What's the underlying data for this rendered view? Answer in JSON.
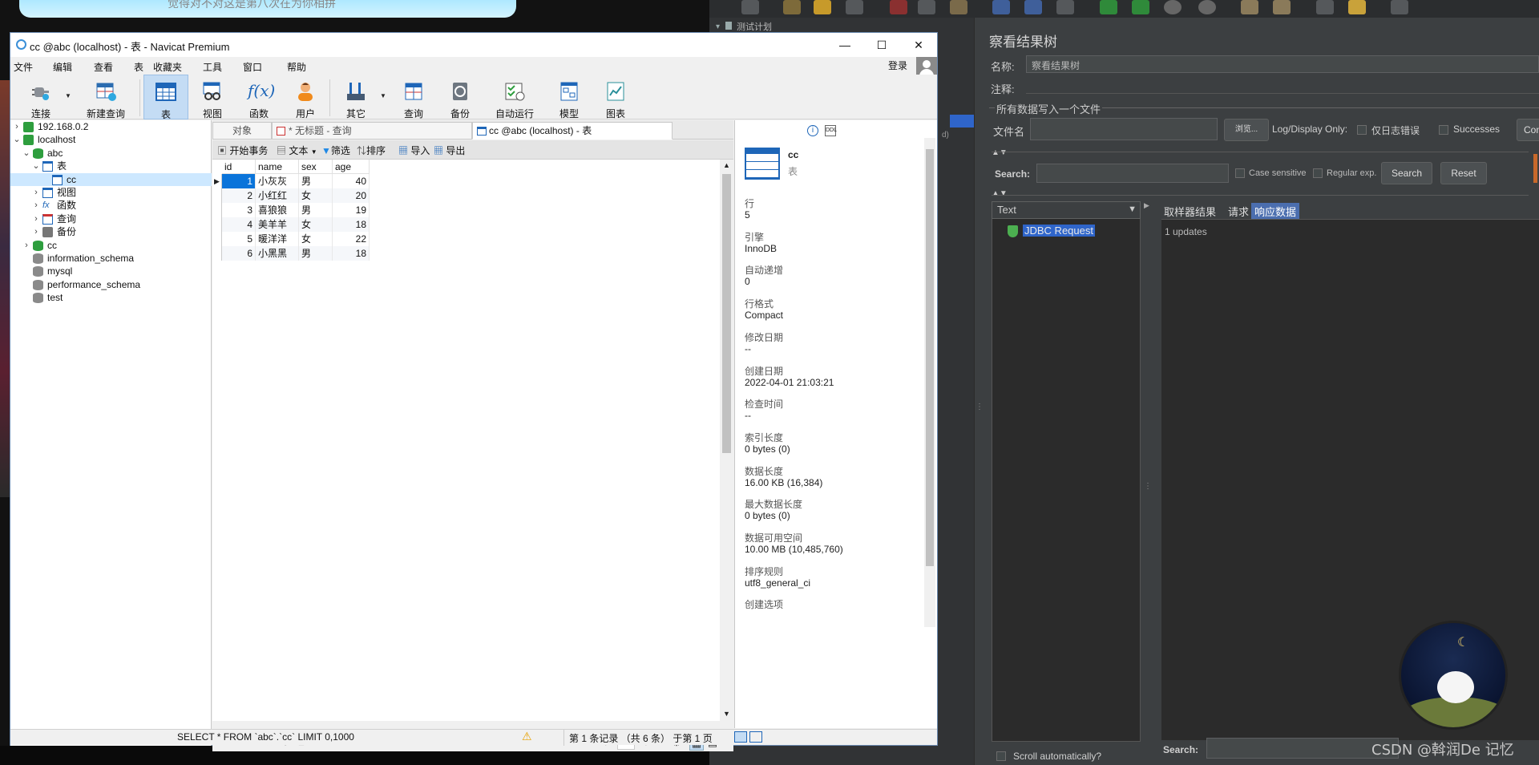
{
  "banner_text": "觉得对不对这是第八次在为你相拼",
  "navicat": {
    "window_title": "cc @abc (localhost) - 表 - Navicat Premium",
    "menu": [
      "文件",
      "编辑",
      "查看",
      "表",
      "收藏夹",
      "工具",
      "窗口",
      "帮助"
    ],
    "login": "登录",
    "toolbar": [
      {
        "label": "连接",
        "icon": "plug-icon"
      },
      {
        "label": "新建查询",
        "icon": "new-query-icon"
      },
      {
        "label": "表",
        "icon": "table-icon",
        "active": true
      },
      {
        "label": "视图",
        "icon": "view-icon"
      },
      {
        "label": "函数",
        "icon": "function-icon"
      },
      {
        "label": "用户",
        "icon": "user-icon"
      },
      {
        "label": "其它",
        "icon": "tools-icon"
      },
      {
        "label": "查询",
        "icon": "query-icon"
      },
      {
        "label": "备份",
        "icon": "backup-icon"
      },
      {
        "label": "自动运行",
        "icon": "schedule-icon"
      },
      {
        "label": "模型",
        "icon": "model-icon"
      },
      {
        "label": "图表",
        "icon": "chart-icon"
      }
    ],
    "tree": [
      {
        "label": "192.168.0.2",
        "level": 0,
        "chev": "›",
        "icon": "server-icon"
      },
      {
        "label": "localhost",
        "level": 0,
        "chev": "⌄",
        "icon": "server-icon"
      },
      {
        "label": "abc",
        "level": 1,
        "chev": "⌄",
        "icon": "database-icon"
      },
      {
        "label": "表",
        "level": 2,
        "chev": "⌄",
        "icon": "table-icon"
      },
      {
        "label": "cc",
        "level": 3,
        "chev": "",
        "icon": "table-icon",
        "selected": true
      },
      {
        "label": "视图",
        "level": 2,
        "chev": "›",
        "icon": "view-icon"
      },
      {
        "label": "函数",
        "level": 2,
        "chev": "›",
        "icon": "function-icon"
      },
      {
        "label": "查询",
        "level": 2,
        "chev": "›",
        "icon": "query-icon"
      },
      {
        "label": "备份",
        "level": 2,
        "chev": "›",
        "icon": "backup-icon"
      },
      {
        "label": "cc",
        "level": 1,
        "chev": "›",
        "icon": "database-icon"
      },
      {
        "label": "information_schema",
        "level": 1,
        "chev": "",
        "icon": "database-icon"
      },
      {
        "label": "mysql",
        "level": 1,
        "chev": "",
        "icon": "database-icon"
      },
      {
        "label": "performance_schema",
        "level": 1,
        "chev": "",
        "icon": "database-icon"
      },
      {
        "label": "test",
        "level": 1,
        "chev": "",
        "icon": "database-icon"
      }
    ],
    "tabs": {
      "objects": "对象",
      "query": "* 无标题 - 查询",
      "table": "cc @abc (localhost) - 表"
    },
    "gridbar": {
      "begin": "开始事务",
      "text": "文本",
      "filter": "筛选",
      "sort": "排序",
      "import": "导入",
      "export": "导出"
    },
    "columns": [
      "id",
      "name",
      "sex",
      "age"
    ],
    "rows": [
      [
        "1",
        "小灰灰",
        "男",
        "40"
      ],
      [
        "2",
        "小红红",
        "女",
        "20"
      ],
      [
        "3",
        "喜狼狼",
        "男",
        "19"
      ],
      [
        "4",
        "美羊羊",
        "女",
        "18"
      ],
      [
        "5",
        "暖洋洋",
        "女",
        "22"
      ],
      [
        "6",
        "小黑黑",
        "男",
        "18"
      ]
    ],
    "page_number": "1",
    "status_sql": "SELECT * FROM `abc`.`cc` LIMIT 0,1000",
    "status_records": "第 1 条记录 （共 6 条） 于第 1 页",
    "info": {
      "name": "cc",
      "type": "表",
      "fields": [
        {
          "label": "行",
          "value": "5"
        },
        {
          "label": "引擎",
          "value": "InnoDB"
        },
        {
          "label": "自动递增",
          "value": "0"
        },
        {
          "label": "行格式",
          "value": "Compact"
        },
        {
          "label": "修改日期",
          "value": "--"
        },
        {
          "label": "创建日期",
          "value": "2022-04-01 21:03:21"
        },
        {
          "label": "检查时间",
          "value": "--"
        },
        {
          "label": "索引长度",
          "value": "0 bytes (0)"
        },
        {
          "label": "数据长度",
          "value": "16.00 KB (16,384)"
        },
        {
          "label": "最大数据长度",
          "value": "0 bytes (0)"
        },
        {
          "label": "数据可用空间",
          "value": "10.00 MB (10,485,760)"
        },
        {
          "label": "排序规则",
          "value": "utf8_general_ci"
        },
        {
          "label": "创建选项",
          "value": ""
        }
      ]
    }
  },
  "jmeter": {
    "tree_item": "测试计划",
    "tree_side_text": "d)",
    "title": "察看结果树",
    "name_label": "名称:",
    "name_value": "察看结果树",
    "comment_label": "注释:",
    "fieldset_title": "所有数据写入一个文件",
    "file_label": "文件名",
    "browse": "浏览...",
    "log_display": "Log/Display Only:",
    "errors_only": "仅日志错误",
    "successes": "Successes",
    "configure": "Con",
    "search_label": "Search:",
    "case_sensitive": "Case sensitive",
    "regular_exp": "Regular exp.",
    "search_btn": "Search",
    "reset_btn": "Reset",
    "renderer": "Text",
    "request_item": "JDBC Request",
    "tabs": [
      "取样器结果",
      "请求",
      "响应数据"
    ],
    "response_text": "1 updates",
    "scroll_auto": "Scroll automatically?",
    "bottom_search": "Search:"
  },
  "watermark": "CSDN @斡润De 记忆"
}
